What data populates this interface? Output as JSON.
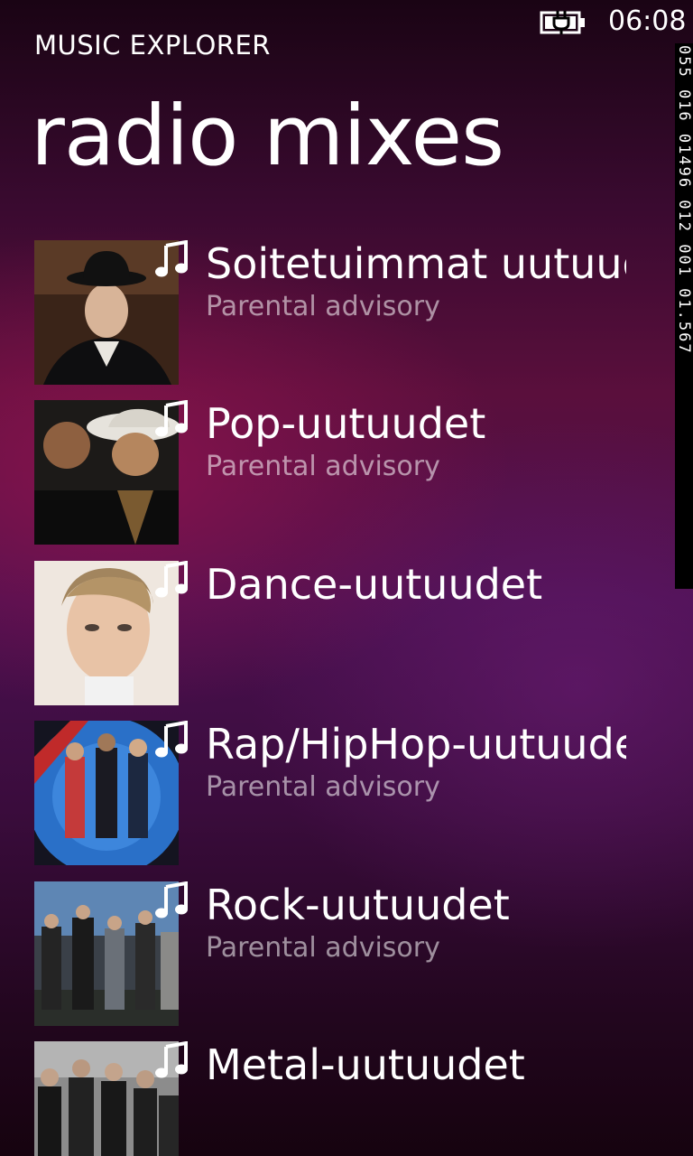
{
  "status_bar": {
    "time": "06:08",
    "battery_icon": "battery-charging-icon"
  },
  "app_title": "MUSIC EXPLORER",
  "page_title": "radio mixes",
  "debug_counter": "055 016 01496 012 001 01.567",
  "items": [
    {
      "title": "Soitetuimmat uutuudet",
      "subtitle": "Parental advisory",
      "icon": "music-note-icon"
    },
    {
      "title": "Pop-uutuudet",
      "subtitle": "Parental advisory",
      "icon": "music-note-icon"
    },
    {
      "title": "Dance-uutuudet",
      "subtitle": "",
      "icon": "music-note-icon"
    },
    {
      "title": "Rap/HipHop-uutuudet",
      "subtitle": "Parental advisory",
      "icon": "music-note-icon"
    },
    {
      "title": "Rock-uutuudet",
      "subtitle": "Parental advisory",
      "icon": "music-note-icon"
    },
    {
      "title": "Metal-uutuudet",
      "subtitle": "",
      "icon": "music-note-icon"
    }
  ]
}
